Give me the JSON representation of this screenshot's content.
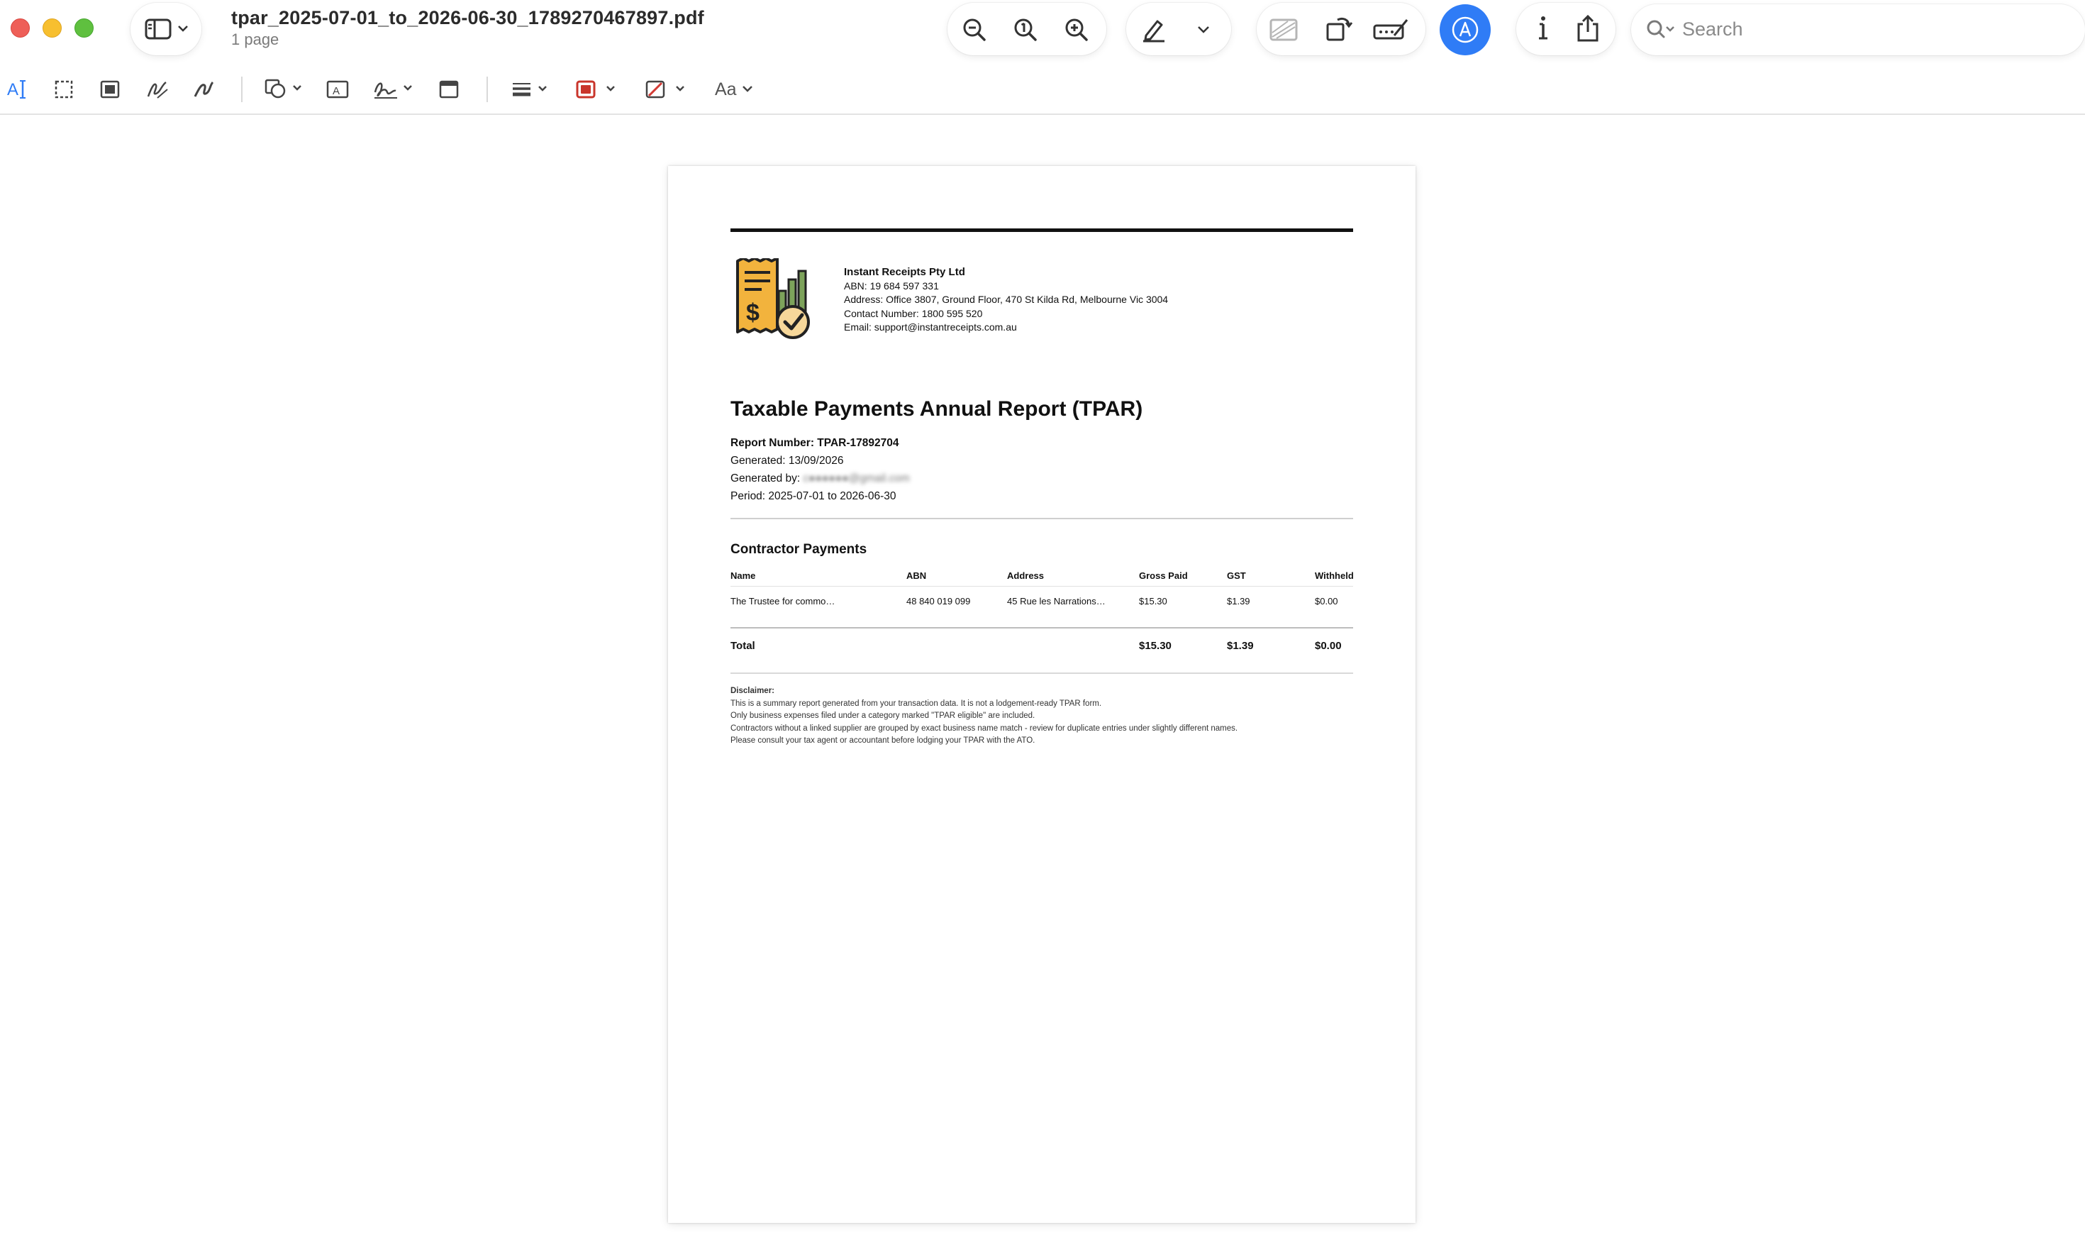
{
  "window": {
    "title": "tpar_2025-07-01_to_2026-06-30_1789270467897.pdf",
    "subtitle": "1 page"
  },
  "toolbar": {
    "search_placeholder": "Search",
    "icons": [
      "sidebar-icon",
      "chevron-down-icon",
      "zoom-out-icon",
      "actual-size-icon",
      "zoom-in-icon",
      "highlight-pen-icon",
      "chevron-down-icon",
      "image-icon",
      "rotate-icon",
      "redact-icon",
      "markup-icon",
      "info-icon",
      "share-icon",
      "search-icon"
    ],
    "accent": "#2f7cf6"
  },
  "markup_toolbar": {
    "items": [
      "text-selection-icon",
      "rectangular-selection-icon",
      "smart-lasso-icon",
      "sketch-icon",
      "draw-icon",
      "shapes-icon",
      "text-box-icon",
      "sign-icon",
      "note-icon",
      "border-style-icon",
      "border-color-icon",
      "fill-color-icon",
      "text-style-icon"
    ],
    "text_style_label": "Aa",
    "border_color": "#c9352b",
    "fill_color": "#d33b35"
  },
  "document": {
    "company": {
      "name": "Instant Receipts Pty Ltd",
      "abn": "ABN: 19 684 597 331",
      "address": "Address: Office 3807, Ground Floor, 470 St Kilda Rd, Melbourne Vic 3004",
      "contact": "Contact Number: 1800 595 520",
      "email": "Email: support@instantreceipts.com.au"
    },
    "report_title": "Taxable Payments Annual Report (TPAR)",
    "report_number": "Report Number: TPAR-17892704",
    "generated": "Generated: 13/09/2026",
    "generated_by_label": "Generated by:",
    "generated_by_value": "c●●●●●●@gmail.com",
    "period": "Period: 2025-07-01 to 2026-06-30",
    "section_title": "Contractor Payments",
    "columns": [
      "Name",
      "ABN",
      "Address",
      "Gross Paid",
      "GST",
      "Withheld"
    ],
    "rows": [
      [
        "The Trustee for commo…",
        "48 840 019 099",
        "45 Rue les Narrations…",
        "$15.30",
        "$1.39",
        "$0.00"
      ]
    ],
    "total": {
      "label": "Total",
      "gross": "$15.30",
      "gst": "$1.39",
      "withheld": "$0.00"
    },
    "disclaimer": {
      "heading": "Disclaimer:",
      "lines": [
        "This is a summary report generated from your transaction data. It is not a lodgement-ready TPAR form.",
        "Only business expenses filed under a category marked \"TPAR eligible\" are included.",
        "Contractors without a linked supplier are grouped by exact business name match - review for duplicate entries under slightly different names.",
        "Please consult your tax agent or accountant before lodging your TPAR with the ATO."
      ]
    }
  }
}
